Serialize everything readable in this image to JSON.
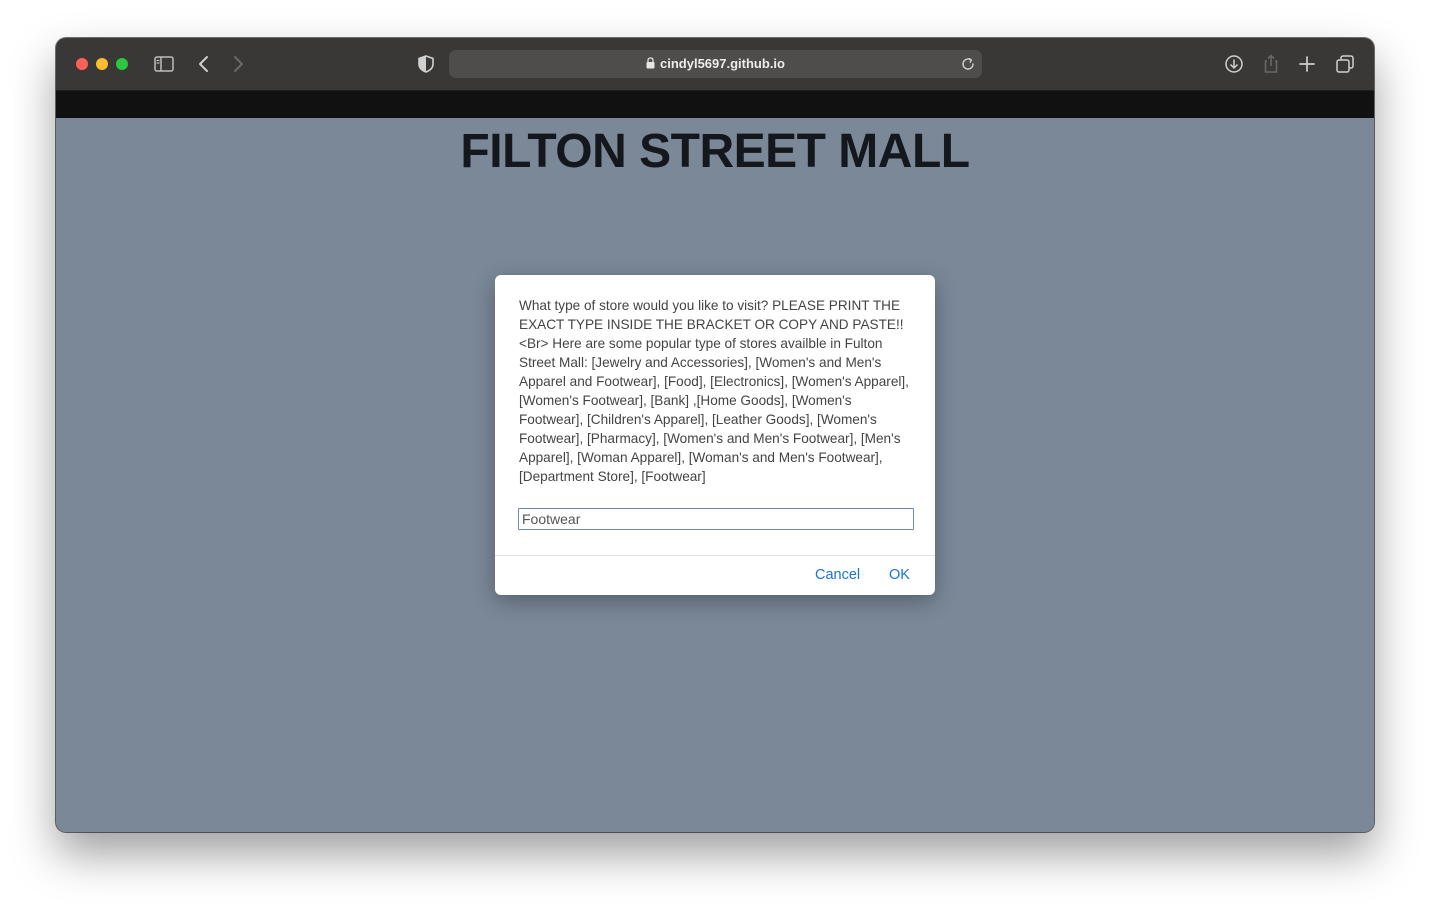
{
  "browser": {
    "url": "cindyl5697.github.io",
    "icons": [
      "sidebar-icon",
      "back-icon",
      "forward-icon",
      "privacy-shield-icon",
      "lock-icon",
      "reload-icon",
      "download-icon",
      "share-icon",
      "new-tab-icon",
      "tab-overview-icon"
    ]
  },
  "page": {
    "title": "FILTON STREET MALL",
    "background_color": "#7a8898"
  },
  "dialog": {
    "message": "What type of store would you like to visit? PLEASE PRINT THE EXACT TYPE INSIDE THE BRACKET OR COPY AND PASTE!! <Br> Here are some popular type of stores availble in Fulton Street Mall: [Jewelry and Accessories], [Women's and Men's Apparel and Footwear], [Food], [Electronics], [Women's Apparel], [Women's Footwear], [Bank] ,[Home Goods], [Women's Footwear], [Children's Apparel], [Leather Goods], [Women's Footwear], [Pharmacy], [Women's and Men's Footwear], [Men's Apparel], [Woman Apparel], [Woman's and Men's Footwear], [Department Store], [Footwear]",
    "input_value": "Footwear",
    "cancel_label": "Cancel",
    "ok_label": "OK",
    "accent_color": "#1a73d6"
  }
}
